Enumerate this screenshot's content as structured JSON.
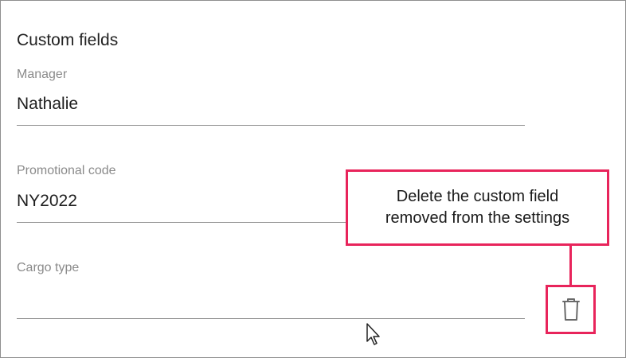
{
  "section": {
    "title": "Custom fields"
  },
  "fields": [
    {
      "label": "Manager",
      "value": "Nathalie"
    },
    {
      "label": "Promotional code",
      "value": "NY2022"
    },
    {
      "label": "Cargo type",
      "value": ""
    }
  ],
  "callout": {
    "line1": "Delete the custom field",
    "line2": "removed from the settings"
  },
  "delete_button": {
    "icon": "trash-icon"
  },
  "colors": {
    "highlight": "#e8245b",
    "label": "#8a8a8a",
    "text": "#1e1e1e",
    "underline": "#8c8c8c"
  }
}
